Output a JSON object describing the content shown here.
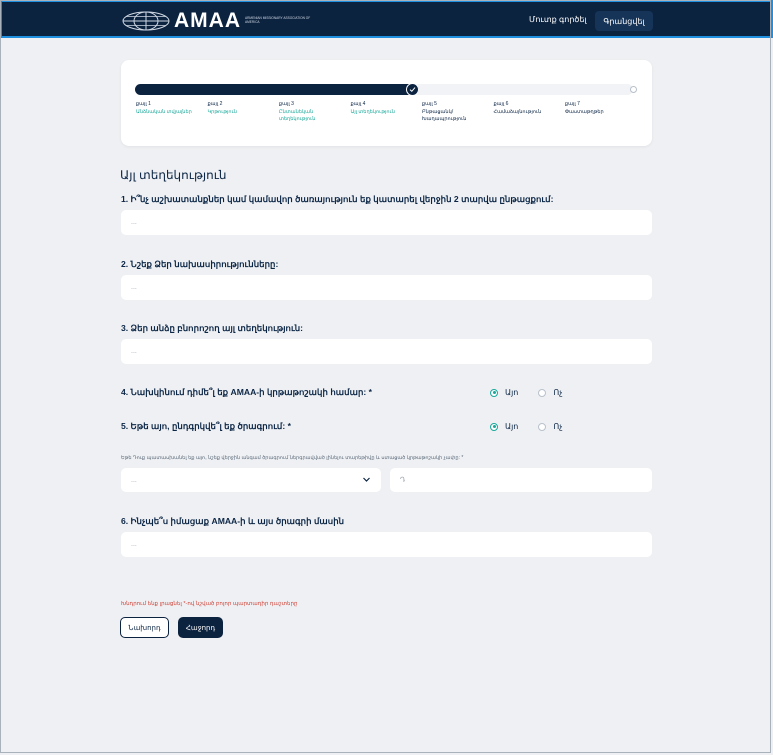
{
  "header": {
    "logo_text": "AMAA",
    "logo_subtitle": "ARMENIAN MISSIONARY ASSOCIATION OF AMERICA",
    "login_label": "Մուտք գործել",
    "register_label": "Գրանցվել"
  },
  "progress": {
    "completed_fraction": 0.57,
    "steps": [
      {
        "number": "քայլ 1",
        "label": "Անձնական տվյալներ"
      },
      {
        "number": "քայլ 2",
        "label": "Կրթություն"
      },
      {
        "number": "քայլ 3",
        "label": "Ընտանեկան տեղեկություն"
      },
      {
        "number": "քայլ 4",
        "label": "Այլ տեղեկություն"
      },
      {
        "number": "քայլ 5",
        "label": "Բնթացանկ/ Խաղապրություն"
      },
      {
        "number": "քայլ 6",
        "label": "Համաձայնություն"
      },
      {
        "number": "քայլ 7",
        "label": "Փաստաթղթեր"
      }
    ]
  },
  "form": {
    "section_title": "Այլ տեղեկություն",
    "q1": "1. Ի՞նչ աշխատանքներ կամ կամավոր ծառայություն եք կատարել վերջին 2 տարվա ընթացքում:",
    "q2": "2. Նշեք Ձեր նախասիրությունները:",
    "q3": "3. Ձեր անձը բնորոշող այլ տեղեկություն:",
    "q4": "4. Նախկինում դիմե՞լ եք AMAA-ի կրթաթոշակի համար: *",
    "q5": "5. Եթե այո, ընդգրկվե՞լ եք ծրագրում: *",
    "q6": "6. Ինչպե՞ս իմացաք AMAA-ի և այս ծրագրի մասին",
    "placeholder": "...",
    "radio_yes": "Այո",
    "radio_no": "Ոչ",
    "q4_selected": "yes",
    "q5_selected": "yes",
    "hint": "Եթե Դուք պատասխանել եք այո, նշեք վերջին անգամ ծրագրում ներգրավված լինելու տարեթիվը և ստացած կրթաթոշակի չափը: *",
    "select_placeholder": "...",
    "year_placeholder": "Դ",
    "required_note": "Խնդրում ենք լրացնել *-ով նշված բոլոր պարտադիր դաշտերը",
    "prev_label": "Նախորդ",
    "next_label": "Հաջորդ"
  },
  "colors": {
    "navy": "#0c2340",
    "teal": "#1aa89a",
    "error": "#d1453b"
  }
}
